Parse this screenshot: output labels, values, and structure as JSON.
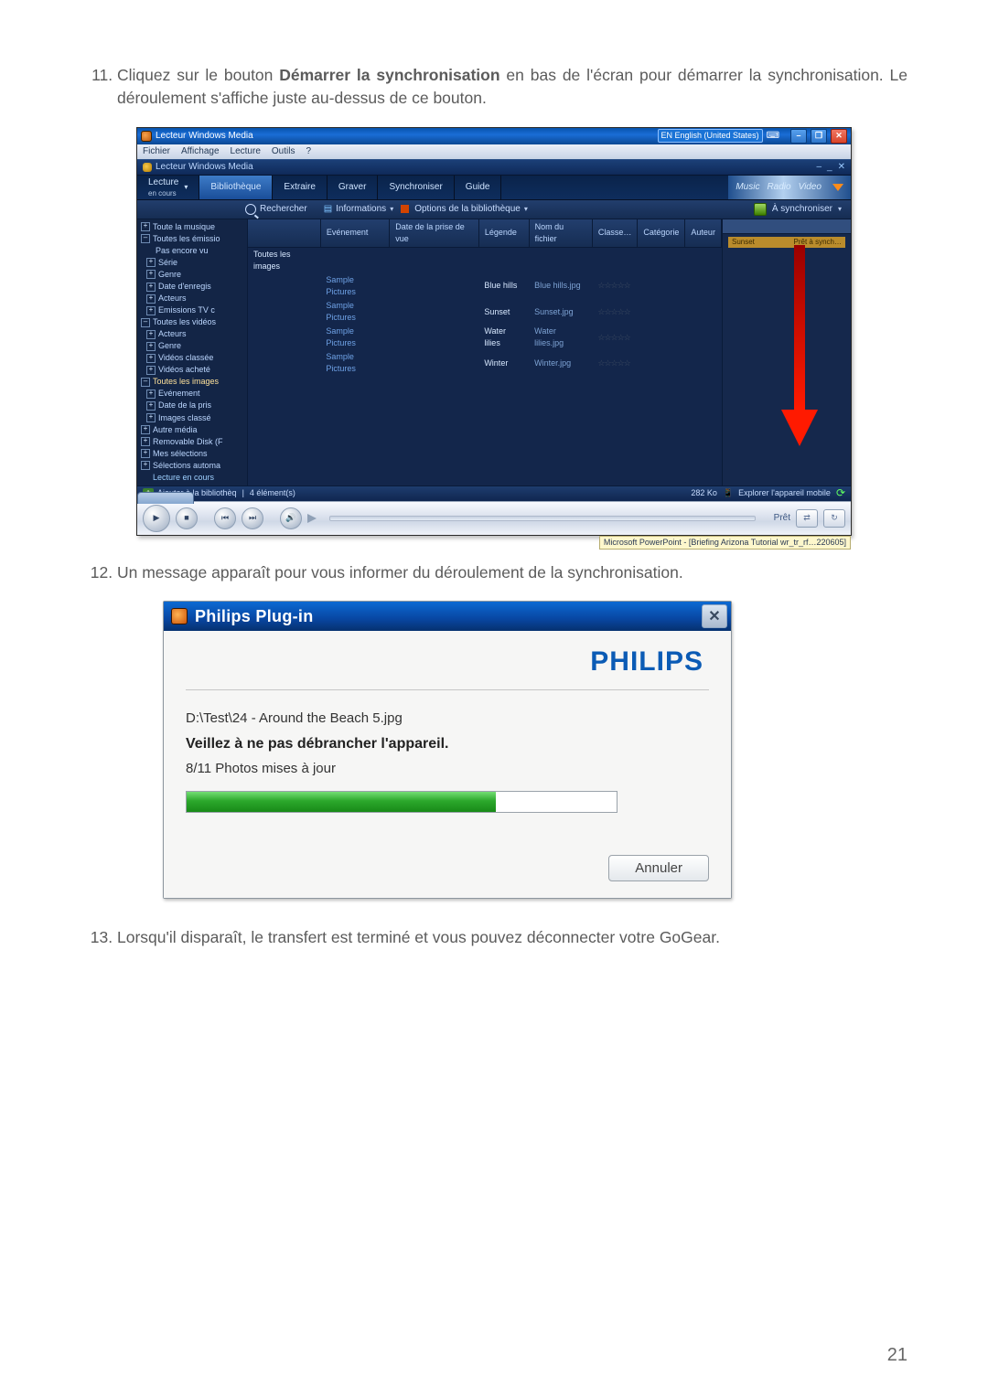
{
  "page_number": "21",
  "steps": {
    "s11": {
      "num": "11.",
      "pre": "Cliquez sur le bouton ",
      "bold": "Démarrer la synchronisation",
      "post": " en bas de l'écran pour démarrer la synchronisation. Le déroulement s'affiche juste au-dessus de ce bouton."
    },
    "s12": {
      "text": "Un message apparaît pour vous informer du déroulement de la synchronisation."
    },
    "s13": {
      "text": "Lorsqu'il disparaît, le transfert est terminé et vous pouvez déconnecter votre GoGear."
    }
  },
  "wmp": {
    "title": "Lecteur Windows Media",
    "language_badge": "EN  English (United States)",
    "keyboard_icon": "⌨",
    "winbtn_min": "–",
    "winbtn_max": "❐",
    "winbtn_close": "✕",
    "menu": [
      "Fichier",
      "Affichage",
      "Lecture",
      "Outils",
      "?"
    ],
    "subtitle_app": "Lecteur Windows Media",
    "subnav": {
      "dash": "–",
      "reduce": "_",
      "close": "✕"
    },
    "tabs": {
      "0": {
        "line1": "Lecture",
        "line2": "en cours"
      },
      "1": "Bibliothèque",
      "2": "Extraire",
      "3": "Graver",
      "4": "Synchroniser",
      "5": "Guide"
    },
    "promo": {
      "music": "Music",
      "radio": "Radio",
      "video": "Video"
    },
    "toolbar": {
      "search": "Rechercher",
      "info": "Informations",
      "libopts": "Options de la bibliothèque",
      "sync": "À synchroniser"
    },
    "rightpane": {
      "thumb_title": "Sunset",
      "thumb_hint": "Prêt à synch…"
    },
    "columns": [
      "",
      "Evénement",
      "Date de la prise de vue",
      "Légende",
      "Nom du fichier",
      "Classe…",
      "Catégorie",
      "Auteur"
    ],
    "rows": [
      {
        "c0": "Toutes les images",
        "c1": "",
        "c2": "",
        "c3": "",
        "c4": "",
        "c5": "",
        "c6": "",
        "c7": ""
      },
      {
        "c0": "",
        "c1": "Sample Pictures",
        "c2": "",
        "c3": "Blue hills",
        "c4": "Blue hills.jpg",
        "c5": "☆☆☆☆☆",
        "c6": "",
        "c7": ""
      },
      {
        "c0": "",
        "c1": "Sample Pictures",
        "c2": "",
        "c3": "Sunset",
        "c4": "Sunset.jpg",
        "c5": "☆☆☆☆☆",
        "c6": "",
        "c7": ""
      },
      {
        "c0": "",
        "c1": "Sample Pictures",
        "c2": "",
        "c3": "Water lilies",
        "c4": "Water lilies.jpg",
        "c5": "☆☆☆☆☆",
        "c6": "",
        "c7": ""
      },
      {
        "c0": "",
        "c1": "Sample Pictures",
        "c2": "",
        "c3": "Winter",
        "c4": "Winter.jpg",
        "c5": "☆☆☆☆☆",
        "c6": "",
        "c7": ""
      }
    ],
    "sidebar": [
      {
        "lvl": 1,
        "exp": "+",
        "label": "Toute la musique"
      },
      {
        "lvl": 1,
        "exp": "–",
        "label": "Toutes les émissio"
      },
      {
        "lvl": 2,
        "exp": "",
        "label": "Pas encore vu"
      },
      {
        "lvl": 2,
        "exp": "+",
        "label": "Série"
      },
      {
        "lvl": 2,
        "exp": "+",
        "label": "Genre"
      },
      {
        "lvl": 2,
        "exp": "+",
        "label": "Date d'enregis"
      },
      {
        "lvl": 2,
        "exp": "+",
        "label": "Acteurs"
      },
      {
        "lvl": 2,
        "exp": "+",
        "label": "Emissions TV c"
      },
      {
        "lvl": 1,
        "exp": "–",
        "label": "Toutes les vidéos"
      },
      {
        "lvl": 2,
        "exp": "+",
        "label": "Acteurs"
      },
      {
        "lvl": 2,
        "exp": "+",
        "label": "Genre"
      },
      {
        "lvl": 2,
        "exp": "+",
        "label": "Vidéos classée"
      },
      {
        "lvl": 2,
        "exp": "+",
        "label": "Vidéos acheté"
      },
      {
        "lvl": 1,
        "exp": "–",
        "label": "Toutes les images",
        "sel": true
      },
      {
        "lvl": 2,
        "exp": "+",
        "label": "Evénement"
      },
      {
        "lvl": 2,
        "exp": "+",
        "label": "Date de la pris"
      },
      {
        "lvl": 2,
        "exp": "+",
        "label": "Images classé"
      },
      {
        "lvl": 1,
        "exp": "+",
        "label": "Autre média"
      },
      {
        "lvl": 1,
        "exp": "+",
        "label": "Removable Disk (F"
      },
      {
        "lvl": 1,
        "exp": "+",
        "label": "Mes sélections"
      },
      {
        "lvl": 1,
        "exp": "+",
        "label": "Sélections automa"
      },
      {
        "lvl": 1,
        "exp": "",
        "label": "Lecture en cours",
        "hi": true
      }
    ],
    "footer": {
      "add": "Ajouter à la bibliothèq",
      "count": "4 élément(s)",
      "size": "282 Ko",
      "explore": "Explorer l'appareil mobile"
    },
    "playbar": {
      "play": "▶",
      "stop": "■",
      "prev": "⏮",
      "next": "⏭",
      "vol": "🔊",
      "status": "Prêt",
      "shuffle": "⇄",
      "repeat": "↻"
    },
    "pp_status": "Microsoft PowerPoint - [Briefing Arizona Tutorial wr_tr_rf…220605]"
  },
  "philips": {
    "title": "Philips Plug-in",
    "close": "✕",
    "brand": "PHILIPS",
    "path": "D:\\Test\\24 - Around the Beach 5.jpg",
    "warn": "Veillez à ne pas débrancher l'appareil.",
    "progress_text": "8/11 Photos mises à jour",
    "cancel": "Annuler"
  }
}
